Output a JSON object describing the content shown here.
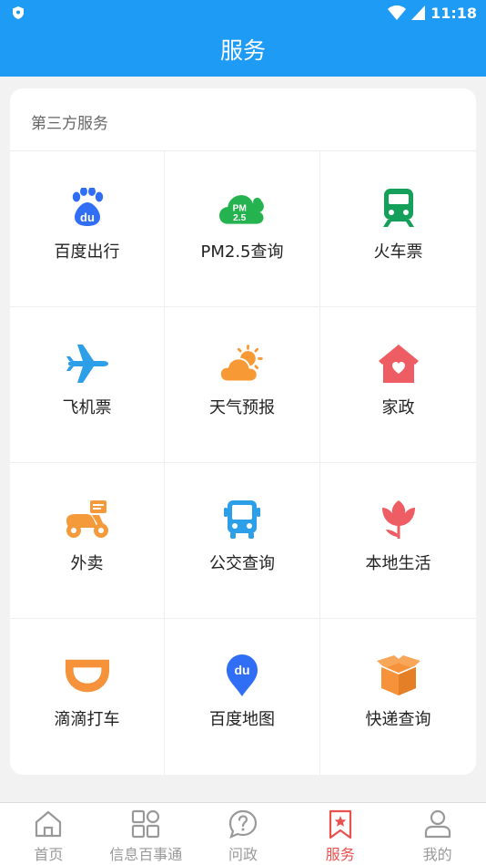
{
  "status_bar": {
    "time": "11:18"
  },
  "header": {
    "title": "服务"
  },
  "section": {
    "title": "第三方服务",
    "services": [
      {
        "label": "百度出行",
        "icon": "baidu-paw-icon",
        "color": "#2f6ef5"
      },
      {
        "label": "PM2.5查询",
        "icon": "pm25-cloud-icon",
        "color": "#24b34f"
      },
      {
        "label": "火车票",
        "icon": "train-icon",
        "color": "#14a05a"
      },
      {
        "label": "飞机票",
        "icon": "airplane-icon",
        "color": "#2d9ee8"
      },
      {
        "label": "天气预报",
        "icon": "weather-sun-cloud-icon",
        "color": "#f79a35"
      },
      {
        "label": "家政",
        "icon": "house-heart-icon",
        "color": "#ee5d63"
      },
      {
        "label": "外卖",
        "icon": "delivery-scooter-icon",
        "color": "#f59a3a"
      },
      {
        "label": "公交查询",
        "icon": "bus-icon",
        "color": "#2d9ee8"
      },
      {
        "label": "本地生活",
        "icon": "tulip-icon",
        "color": "#ee5d63"
      },
      {
        "label": "滴滴打车",
        "icon": "didi-icon",
        "color": "#f6923a"
      },
      {
        "label": "百度地图",
        "icon": "baidu-map-pin-icon",
        "color": "#2f6ef5"
      },
      {
        "label": "快递查询",
        "icon": "package-box-icon",
        "color": "#f6923a"
      }
    ]
  },
  "tabbar": {
    "items": [
      {
        "label": "首页",
        "icon": "home-icon",
        "active": false
      },
      {
        "label": "信息百事通",
        "icon": "grid-apps-icon",
        "active": false
      },
      {
        "label": "问政",
        "icon": "question-bubble-icon",
        "active": false
      },
      {
        "label": "服务",
        "icon": "bookmark-star-icon",
        "active": true
      },
      {
        "label": "我的",
        "icon": "user-icon",
        "active": false
      }
    ],
    "active_color": "#e9504e",
    "inactive_color": "#999999"
  },
  "colors": {
    "header": "#1e9bf4",
    "background": "#f2f2f2"
  }
}
